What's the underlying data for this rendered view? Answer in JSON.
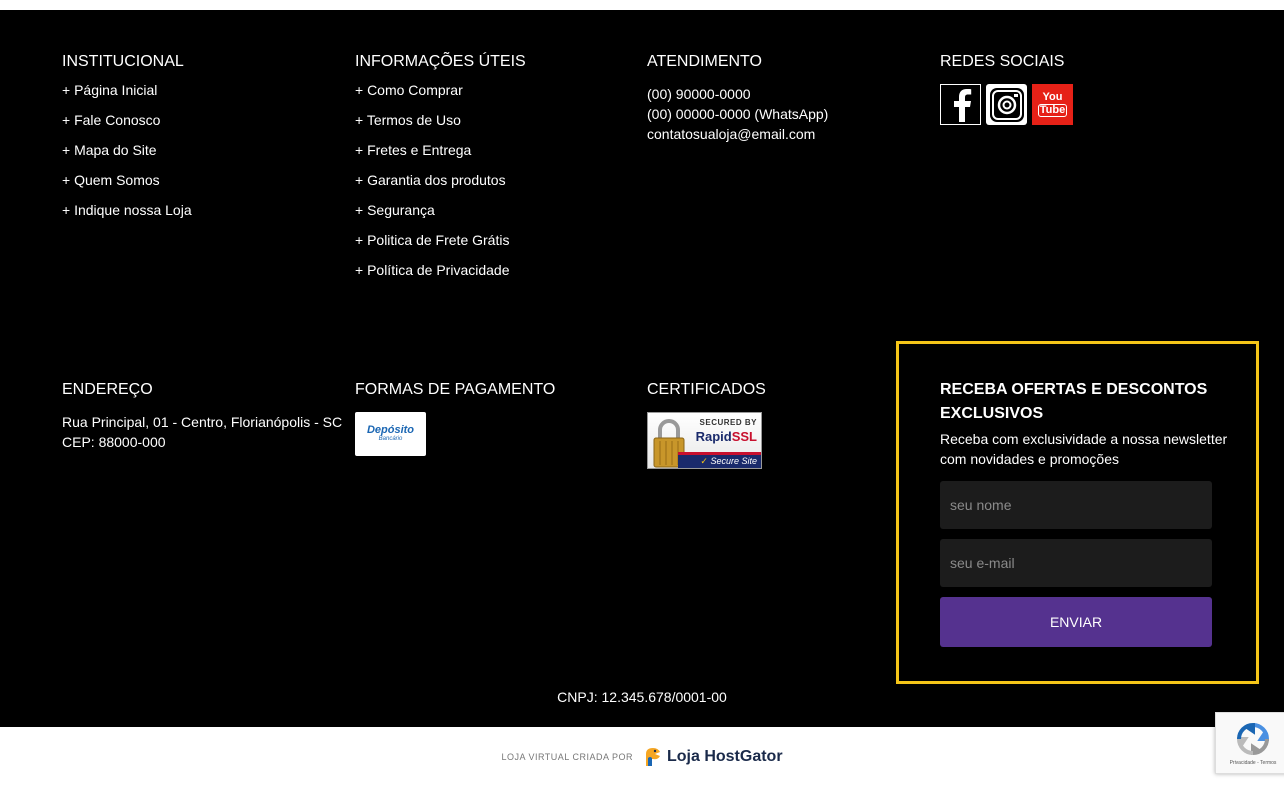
{
  "institucional": {
    "title": "INSTITUCIONAL",
    "links": [
      "+ Página Inicial",
      "+ Fale Conosco",
      "+ Mapa do Site",
      "+ Quem Somos",
      "+ Indique nossa Loja"
    ]
  },
  "informacoes": {
    "title": "INFORMAÇÕES ÚTEIS",
    "links": [
      "+ Como Comprar",
      "+ Termos de Uso",
      "+ Fretes e Entrega",
      "+ Garantia dos produtos",
      "+ Segurança",
      "+ Politica de Frete Grátis",
      "+ Política de Privacidade"
    ]
  },
  "atendimento": {
    "title": "ATENDIMENTO",
    "phone": "(00) 90000-0000",
    "whatsapp": "(00) 00000-0000 (WhatsApp)",
    "email": "contatosualoja@email.com"
  },
  "redes": {
    "title": "REDES SOCIAIS",
    "icons": [
      "facebook-icon",
      "instagram-icon",
      "youtube-icon"
    ],
    "youtube_top": "You",
    "youtube_bottom": "Tube"
  },
  "endereco": {
    "title": "ENDEREÇO",
    "line1": "Rua Principal, 01 - Centro, Florianópolis - SC",
    "line2": "CEP: 88000-000"
  },
  "pagamento": {
    "title": "FORMAS DE PAGAMENTO",
    "deposit_main": "Depósito",
    "deposit_sub": "Bancário"
  },
  "certificados": {
    "title": "CERTIFICADOS",
    "secured_by": "SECURED BY",
    "rapid": "Rapid",
    "ssl": "SSL",
    "secure_site": "Secure Site"
  },
  "newsletter": {
    "title": "RECEBA OFERTAS E DESCONTOS EXCLUSIVOS",
    "description": "Receba com exclusividade a nossa newsletter com novidades e promoções",
    "name_placeholder": "seu nome",
    "email_placeholder": "seu e-mail",
    "submit_label": "ENVIAR",
    "border_color": "#f5c518",
    "button_color": "#55328f"
  },
  "cnpj": "CNPJ: 12.345.678/0001-00",
  "credits": {
    "made_by": "LOJA VIRTUAL CRIADA POR",
    "brand": "Loja HostGator"
  },
  "recaptcha": {
    "text": "Privacidade - Termos"
  }
}
